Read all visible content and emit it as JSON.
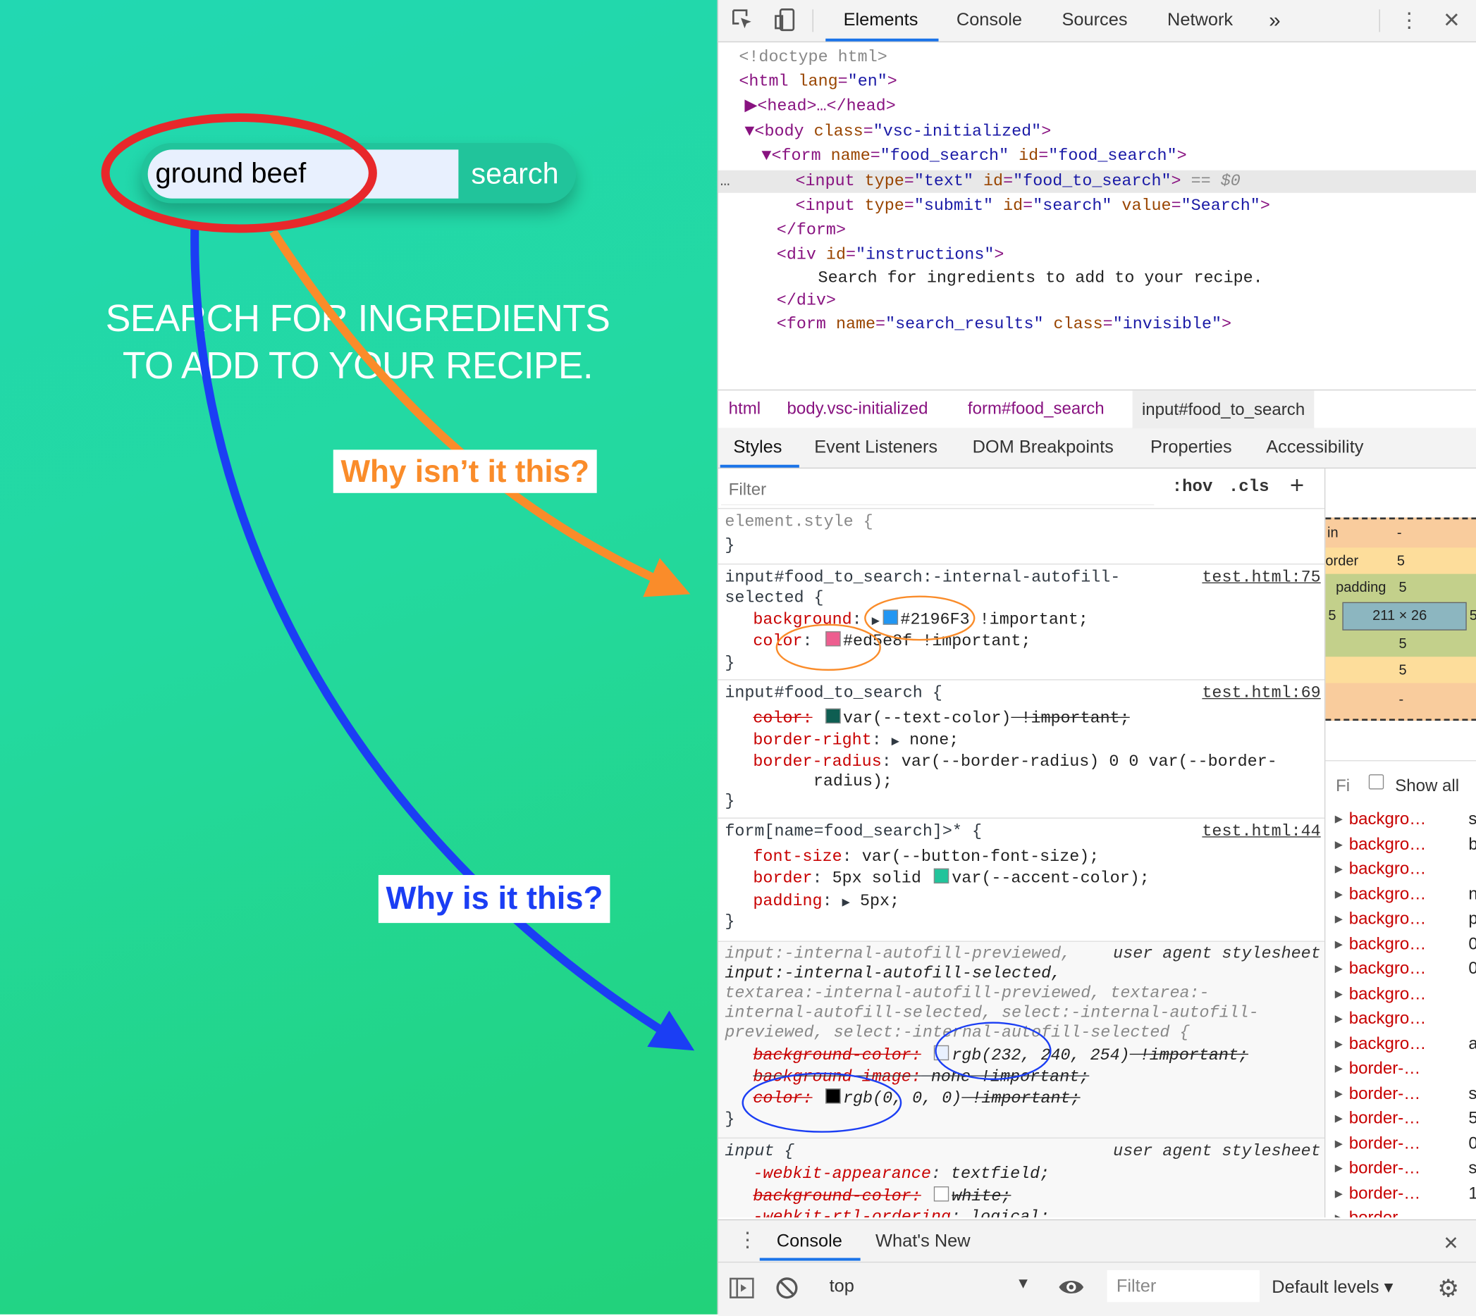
{
  "page": {
    "search_value": "ground beef",
    "search_button": "search",
    "instructions_line1": "SEARCH FOR INGREDIENTS",
    "instructions_line2": "TO ADD TO YOUR RECIPE.",
    "callout_orange": "Why isn’t it this?",
    "callout_blue": "Why is it this?",
    "colors": {
      "orange": "#fa8c2a",
      "blue": "#1b3ef4",
      "red": "#e8282b",
      "input_bg": "#e8f0fe"
    }
  },
  "devtools": {
    "tabs": [
      "Elements",
      "Console",
      "Sources",
      "Network",
      "»"
    ],
    "dom": {
      "l1": "<!doctype html>",
      "l2_tag": "<html ",
      "l2_attr": "lang",
      "l2_val": "\"en\"",
      "l3": "<head>…</head>",
      "l4_tag": "<body ",
      "l4_attr": "class",
      "l4_val": "\"vsc-initialized\"",
      "l5_tag": "<form ",
      "l5_a1": "name",
      "l5_v1": "\"food_search\"",
      "l5_a2": "id",
      "l5_v2": "\"food_search\"",
      "l6_tag": "<input ",
      "l6_a1": "type",
      "l6_v1": "\"text\"",
      "l6_a2": "id",
      "l6_v2": "\"food_to_search\"",
      "l6_suffix": " == $0",
      "l7_tag": "<input ",
      "l7_a1": "type",
      "l7_v1": "\"submit\"",
      "l7_a2": "id",
      "l7_v2": "\"search\"",
      "l7_a3": "value",
      "l7_v3": "\"Search\"",
      "l8": "</form>",
      "l9_tag": "<div ",
      "l9_attr": "id",
      "l9_val": "\"instructions\"",
      "l10": "Search for ingredients to add to your recipe.",
      "l11": "</div>",
      "l12_tag": "<form ",
      "l12_a1": "name",
      "l12_v1": "\"search_results\"",
      "l12_a2": "class",
      "l12_v2": "\"invisible\""
    },
    "breadcrumbs": [
      "html",
      "body.vsc-initialized",
      "form#food_search",
      "input#food_to_search"
    ],
    "subtabs": [
      "Styles",
      "Event Listeners",
      "DOM Breakpoints",
      "Properties",
      "Accessibility"
    ],
    "filter_placeholder": "Filter",
    "hov": ":hov",
    "cls": ".cls",
    "rules": {
      "r0_sel": "element.style {",
      "r1_sel1": "input#food_to_search:-internal-autofill-",
      "r1_sel2": "selected {",
      "r1_src": "test.html:75",
      "r1_p1": "background",
      "r1_v1": "#2196F3",
      "r1_imp": "!important;",
      "r1_p2": "color",
      "r1_v2": "#ed5e8f",
      "r2_sel": "input#food_to_search {",
      "r2_src": "test.html:69",
      "r2_p1": "color:",
      "r2_v1": "var(--text-color)",
      "r2_imp": " !important;",
      "r2_p2": "border-right",
      "r2_v2": "none;",
      "r2_p3": "border-radius",
      "r2_v3a": "var(--border-radius) 0 0 var(--border-",
      "r2_v3b": "radius);",
      "r3_sel": "form[name=food_search]>* {",
      "r3_src": "test.html:44",
      "r3_p1": "font-size",
      "r3_v1": "var(--button-font-size);",
      "r3_p2": "border",
      "r3_v2a": "5px solid",
      "r3_v2b": "var(--accent-color);",
      "r3_p3": "padding",
      "r3_v3": "5px;",
      "r4_l1": "input:-internal-autofill-previewed,",
      "r4_src": "user agent stylesheet",
      "r4_l2": "input:-internal-autofill-selected,",
      "r4_l3": "textarea:-internal-autofill-previewed, textarea:-",
      "r4_l4": "internal-autofill-selected, select:-internal-autofill-",
      "r4_l5": "previewed, select:-internal-autofill-selected {",
      "r4_p1": "background-color:",
      "r4_v1": "rgb(232, 240, 254)",
      "r4_imp1": " !important;",
      "r4_p2": "background-image:",
      "r4_v2": "none !important;",
      "r4_p3": "color:",
      "r4_v3": "rgb(0, 0, 0)",
      "r4_imp3": " !important;",
      "r5_sel": "input {",
      "r5_src": "user agent stylesheet",
      "r5_p1": "-webkit-appearance",
      "r5_v1": "textfield;",
      "r5_p2": "background-color:",
      "r5_v2": "white;",
      "r5_p3": "-webkit-rtl-ordering",
      "r5_v3": "logical;",
      "swatch_colors": {
        "blue": "#2196F3",
        "pink": "#ed5e8f",
        "dark": "#0e5e52",
        "accent": "#21c49b",
        "light": "#e8f0fe",
        "black": "#000000",
        "white": "#ffffff"
      }
    },
    "boxmodel": {
      "margin_label": "in",
      "margin_val": "-",
      "border_label": "order",
      "border_val": "5",
      "padding_label": "padding",
      "padding_val": "5",
      "content": "211 × 26",
      "side_val": "5",
      "bottom_padding": "5",
      "bottom_border": "5",
      "bottom_margin": "-"
    },
    "computed": {
      "filter": "Fi",
      "show_all": "Show all",
      "props": [
        "backgro…",
        "backgro…",
        "backgro…",
        "backgro…",
        "backgro…",
        "backgro…",
        "backgro…",
        "backgro…",
        "backgro…",
        "backgro…",
        "border-…",
        "border-…",
        "border-…",
        "border-…",
        "border-…",
        "border-…",
        "border-…"
      ],
      "vals": [
        "s",
        "b",
        "",
        "n",
        "p",
        "0",
        "0",
        "",
        "",
        "a",
        "",
        "s",
        "5",
        "0",
        "s",
        "1",
        ""
      ]
    },
    "drawer": {
      "tabs": [
        "Console",
        "What's New"
      ],
      "context": "top",
      "filter": "Filter",
      "levels": "Default levels ▾"
    }
  }
}
